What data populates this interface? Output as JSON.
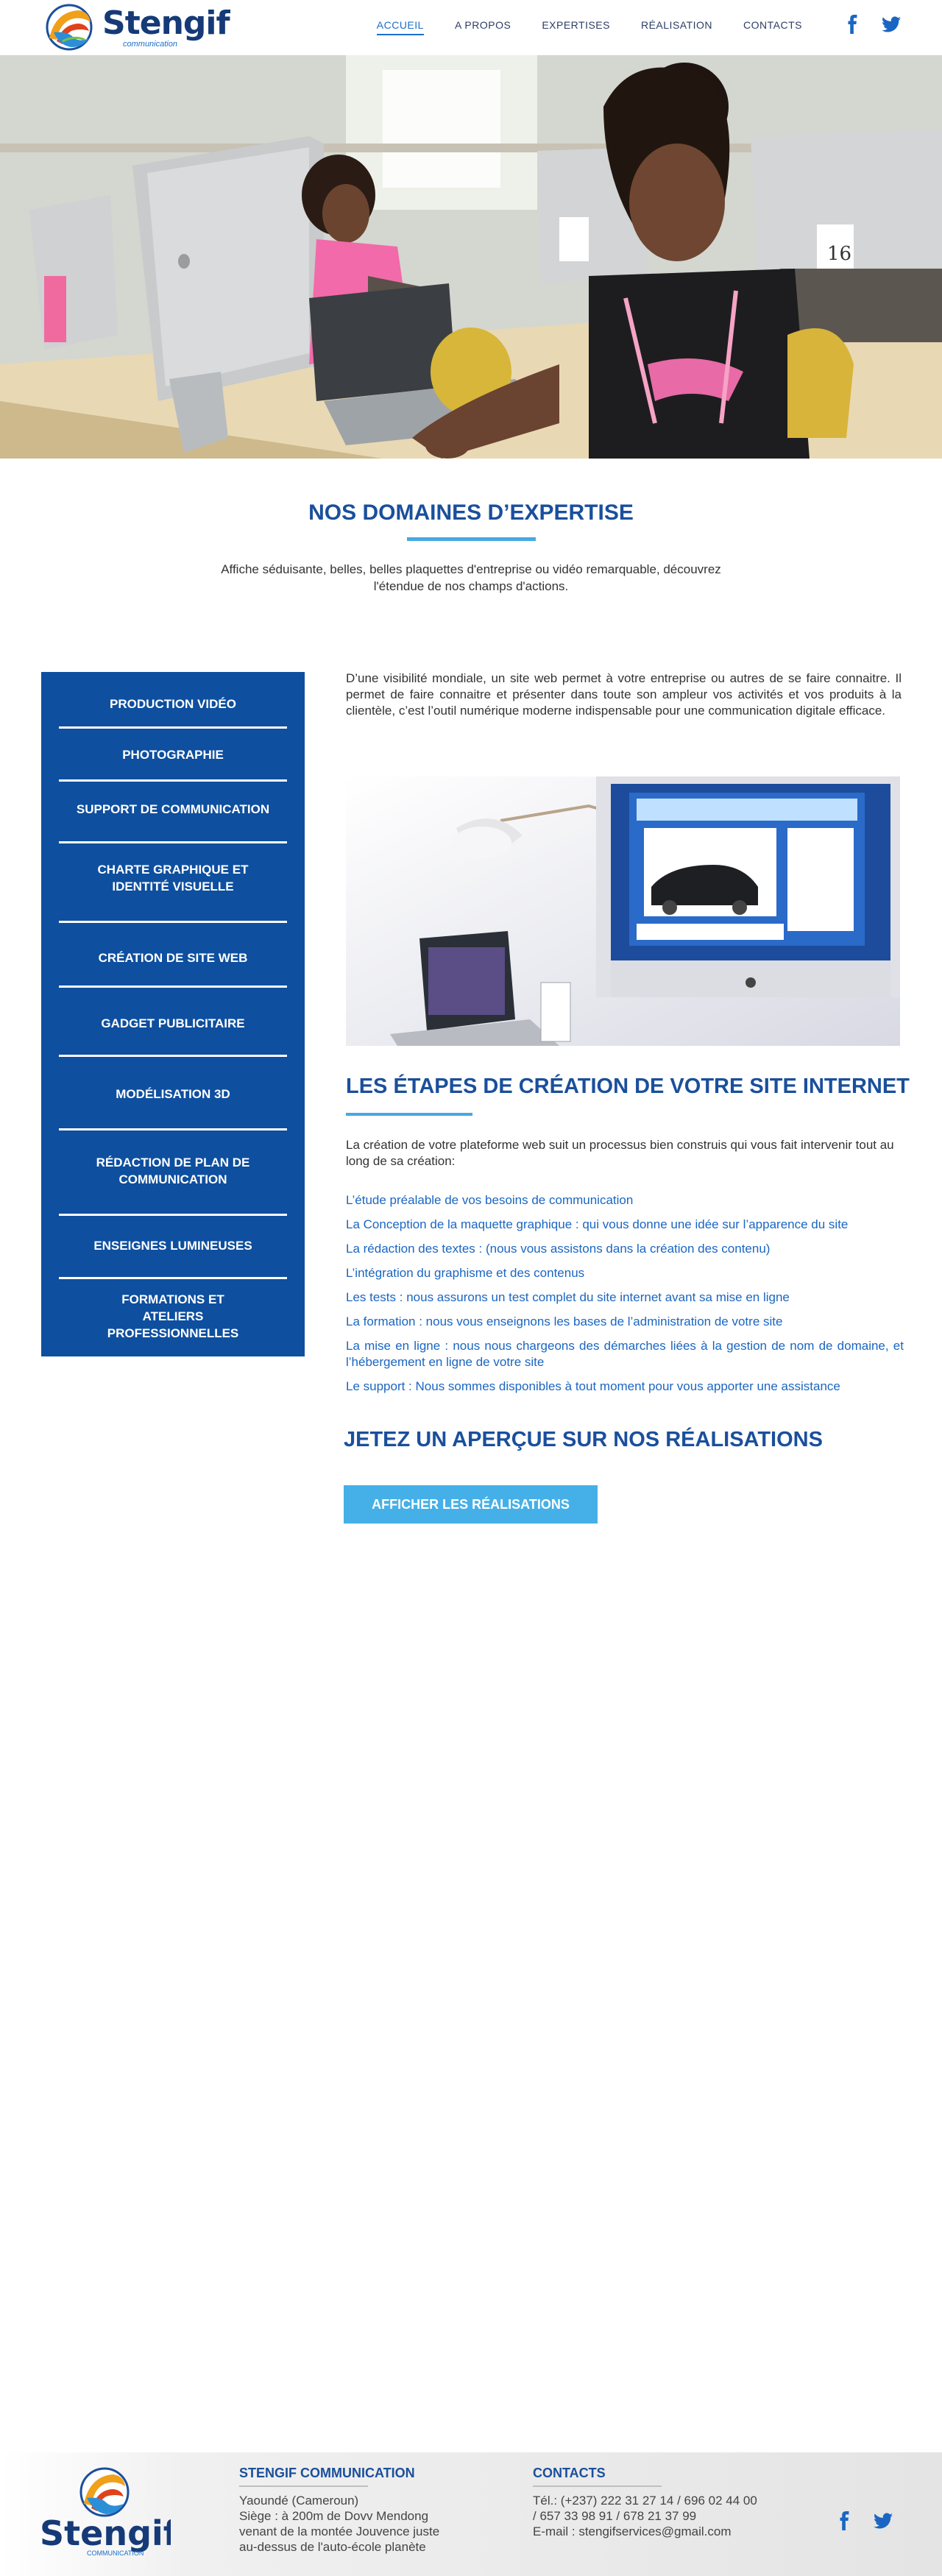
{
  "brand": {
    "name": "Stengif",
    "tagline": "communication",
    "colors": {
      "primary": "#0e4f9f",
      "accent": "#45a9e3",
      "link": "#1a66c2"
    }
  },
  "nav": {
    "items": [
      {
        "label": "ACCUEIL",
        "active": true
      },
      {
        "label": "A PROPOS"
      },
      {
        "label": "EXPERTISES"
      },
      {
        "label": "RÉALISATION"
      },
      {
        "label": "CONTACTS"
      }
    ],
    "social": [
      "facebook-icon",
      "twitter-icon"
    ]
  },
  "expertise": {
    "title": "NOS DOMAINES D’EXPERTISE",
    "intro": "Affiche séduisante, belles, belles plaquettes d'entreprise ou vidéo remarquable, découvrez l'étendue de nos champs d'actions."
  },
  "sidebar": {
    "items": [
      {
        "label": "PRODUCTION VIDÉO"
      },
      {
        "label": "PHOTOGRAPHIE"
      },
      {
        "label": "SUPPORT DE COMMUNICATION"
      },
      {
        "label": "CHARTE GRAPHIQUE ET IDENTITÉ VISUELLE"
      },
      {
        "label": "CRÉATION DE SITE WEB"
      },
      {
        "label": "GADGET PUBLICITAIRE"
      },
      {
        "label": "MODÉLISATION 3D"
      },
      {
        "label": "RÉDACTION DE PLAN DE COMMUNICATION"
      },
      {
        "label": "ENSEIGNES LUMINEUSES"
      },
      {
        "label": "FORMATIONS ET ATELIERS PROFESSIONNELLES"
      }
    ]
  },
  "main": {
    "paragraph": "D’une visibilité mondiale, un site web permet à votre entreprise ou autres de se faire connaitre. Il permet de faire connaitre et présenter dans toute son ampleur vos activités et vos produits à la clientèle, c’est l’outil numérique moderne indispensable pour une communication digitale efficace.",
    "steps_title": "LES ÉTAPES DE CRÉATION DE VOTRE SITE INTERNET",
    "steps_intro": "La création de votre plateforme web suit un processus bien construis qui vous fait intervenir tout au long de sa création:",
    "steps": [
      "L’étude préalable de vos besoins de communication",
      "La Conception de la maquette graphique : qui vous donne une idée sur l’apparence du site",
      "La rédaction des textes :  (nous vous assistons dans la création des contenu)",
      "L’intégration du graphisme et des contenus",
      "Les tests : nous assurons un test complet du site internet avant sa mise en ligne",
      "La formation : nous vous enseignons les bases de l’administration de votre site",
      "La mise en ligne : nous nous chargeons des démarches liées à la gestion de nom de domaine, et l’hébergement en ligne de votre site",
      "Le support : Nous sommes disponibles à tout moment pour vous apporter une assistance"
    ],
    "realisations_title": "JETEZ UN APERÇUE SUR NOS RÉALISATIONS",
    "button_label": "AFFICHER LES RÉALISATIONS"
  },
  "footer": {
    "logo_text": "Stengif",
    "logo_sub": "COMMUNICATION",
    "company_title": "STENGIF COMMUNICATION",
    "company_lines": [
      "Yaoundé (Cameroun)",
      "Siège : à 200m de Dovv Mendong",
      "venant de la montée Jouvence juste",
      "au-dessus de l'auto-école planète"
    ],
    "contacts_title": "CONTACTS",
    "contact_lines": [
      "Tél.: (+237) 222 31 27 14 / 696 02 44 00",
      "/ 657 33 98 91 / 678 21 37 99",
      "E-mail : stengifservices@gmail.com"
    ]
  }
}
